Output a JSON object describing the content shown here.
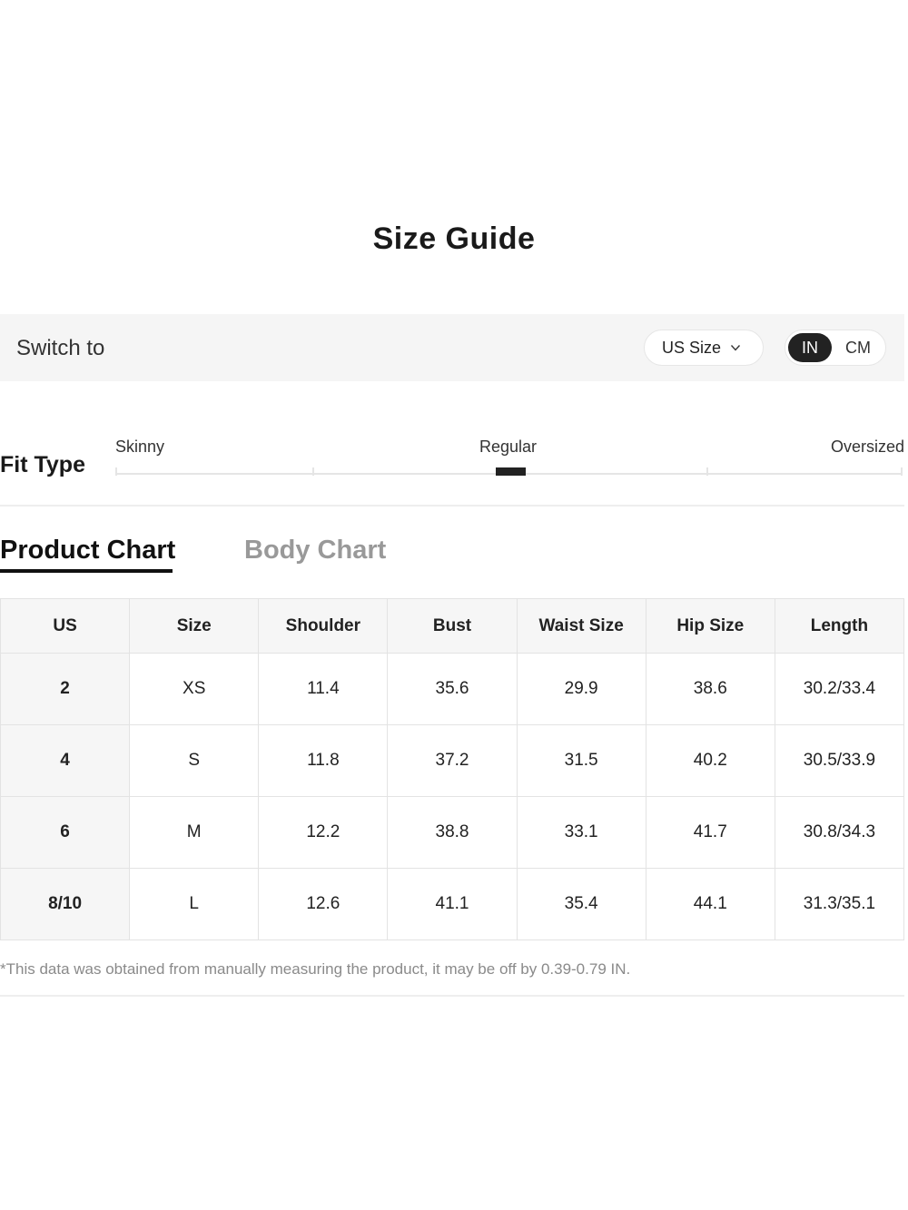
{
  "title": "Size Guide",
  "switch_bar": {
    "label": "Switch to",
    "size_system": "US Size",
    "units": {
      "active": "IN",
      "inactive": "CM"
    }
  },
  "fit_type": {
    "label": "Fit Type",
    "options": [
      "Skinny",
      "Regular",
      "Oversized"
    ],
    "selected": "Regular"
  },
  "tabs": {
    "product": "Product Chart",
    "body": "Body Chart",
    "active": "Product Chart"
  },
  "table": {
    "headers": [
      "US",
      "Size",
      "Shoulder",
      "Bust",
      "Waist Size",
      "Hip Size",
      "Length"
    ],
    "rows": [
      [
        "2",
        "XS",
        "11.4",
        "35.6",
        "29.9",
        "38.6",
        "30.2/33.4"
      ],
      [
        "4",
        "S",
        "11.8",
        "37.2",
        "31.5",
        "40.2",
        "30.5/33.9"
      ],
      [
        "6",
        "M",
        "12.2",
        "38.8",
        "33.1",
        "41.7",
        "30.8/34.3"
      ],
      [
        "8/10",
        "L",
        "12.6",
        "41.1",
        "35.4",
        "44.1",
        "31.3/35.1"
      ]
    ]
  },
  "footnote": "*This data was obtained from manually measuring the product, it may be off by 0.39-0.79 IN.",
  "icons": {
    "size_dropdown": "chevron-down-icon"
  },
  "colors": {
    "accent": "#222222",
    "bar_background": "#f5f5f5",
    "header_background": "#f6f6f6",
    "muted_text": "#999999"
  }
}
